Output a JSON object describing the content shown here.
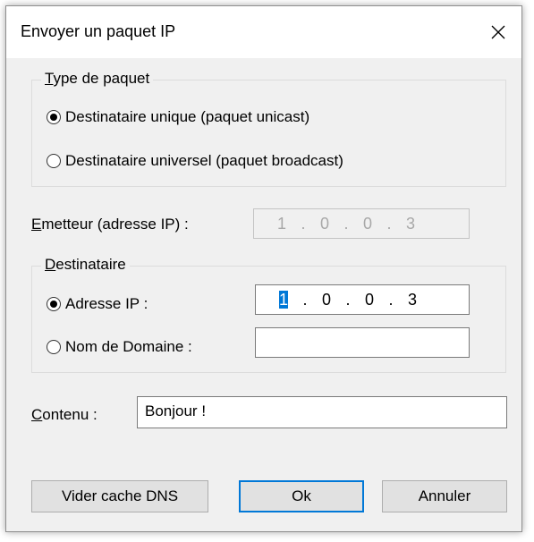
{
  "window": {
    "title": "Envoyer un paquet IP",
    "close_icon": "close-icon"
  },
  "packet_type": {
    "legend_prefix": "T",
    "legend_rest": "ype de paquet",
    "unicast_label": "Destinataire unique (paquet unicast)",
    "broadcast_label": "Destinataire universel (paquet broadcast)",
    "selected": "unicast"
  },
  "sender": {
    "label_prefix": "E",
    "label_rest": "metteur (adresse IP) :",
    "ip": [
      "1",
      "0",
      "0",
      "3"
    ]
  },
  "recipient": {
    "legend_prefix": "D",
    "legend_rest": "estinataire",
    "ip_label": "Adresse IP :",
    "domain_label": "Nom de Domaine :",
    "selected": "ip",
    "ip": [
      "1",
      "0",
      "0",
      "3"
    ],
    "domain_value": ""
  },
  "content": {
    "label_prefix": "C",
    "label_rest": "ontenu :",
    "value": "Bonjour !"
  },
  "buttons": {
    "clear_dns": "Vider cache DNS",
    "ok": "Ok",
    "cancel": "Annuler"
  }
}
